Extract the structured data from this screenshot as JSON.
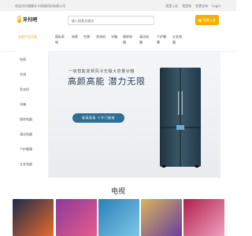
{
  "topbar": {
    "welcome": "欢迎访问顺徽丰卡网络科技有限公司",
    "links": [
      "我是入驻",
      "我是购",
      "免费发布",
      "Login"
    ]
  },
  "header": {
    "logo_text": "牙扫吧",
    "search_placeholder": "输入搜索关键词",
    "login_label": "免费入驻",
    "user_icon": "user-icon"
  },
  "nav": {
    "all_categories": "全部产品分类",
    "items": [
      "国际家电",
      "电视",
      "空调",
      "洗衣机",
      "冰箱",
      "厨房电器",
      "清洁电器",
      "个护健康",
      "五金电器"
    ]
  },
  "sidebar": {
    "categories": [
      "电视",
      "空调",
      "洗衣机",
      "冰箱",
      "厨房电器",
      "清洁电器",
      "个护健康",
      "五金电器"
    ]
  },
  "banner": {
    "subtitle": "一级智能变频风冷无霜大容量冰箱",
    "headline": "高颜高能 潜力无限",
    "cta_label": "玻璃面板 十字门能效",
    "fridge_color": "#2f4a5a"
  },
  "section": {
    "title": "电视"
  },
  "products": [
    {
      "name": "tv-1",
      "colors": [
        "#1d2b4a",
        "#e86b2d"
      ]
    },
    {
      "name": "tv-2",
      "colors": [
        "#8a3b9c",
        "#e85a8a"
      ]
    },
    {
      "name": "tv-3",
      "colors": [
        "#2c7fb8",
        "#7dc6e8"
      ]
    },
    {
      "name": "tv-4",
      "colors": [
        "#d9b45a",
        "#6a3ea1"
      ]
    },
    {
      "name": "tv-5",
      "colors": [
        "#b01f4a",
        "#f0a0c0"
      ]
    }
  ]
}
